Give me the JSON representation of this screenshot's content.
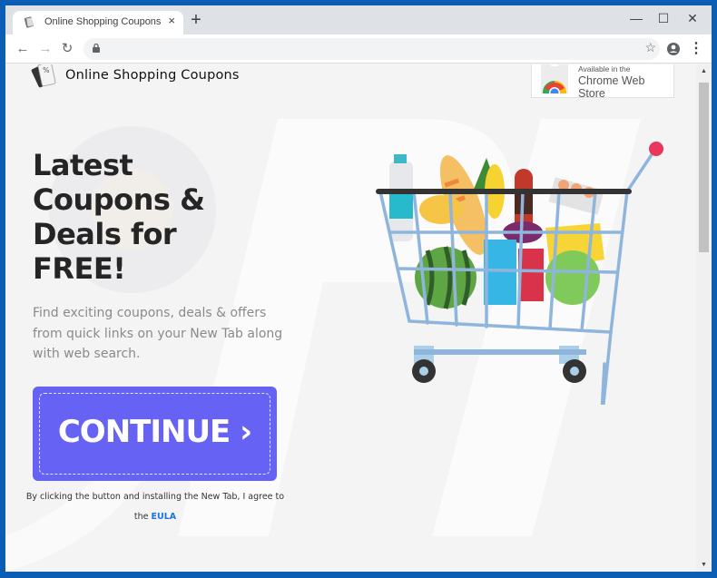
{
  "browser": {
    "tab": {
      "title": "Online Shopping Coupons",
      "close": "×"
    },
    "new_tab": "+",
    "window_controls": {
      "minimize": "—",
      "maximize": "☐",
      "close": "✕"
    },
    "toolbar": {
      "back": "←",
      "forward": "→",
      "reload": "↻",
      "url": "",
      "bookmark": "☆",
      "menu": "⋮"
    }
  },
  "page": {
    "logo_text": "Online Shopping Coupons",
    "store_badge": {
      "small": "Available in the",
      "big": "Chrome Web Store"
    },
    "headline": [
      "Latest",
      "Coupons &",
      "Deals for",
      "FREE!"
    ],
    "subtext": "Find exciting coupons, deals & offers from quick links on your New Tab along with web search.",
    "cta": {
      "label": "CONTINUE ›",
      "color": "#6662f3"
    },
    "agreement": {
      "line1": "By clicking the button and installing the New Tab, I agree to",
      "prefix": "the",
      "link": "EULA"
    }
  },
  "scrollbar": {
    "up": "▲",
    "down": "▼",
    "position_fraction": 0.0
  }
}
